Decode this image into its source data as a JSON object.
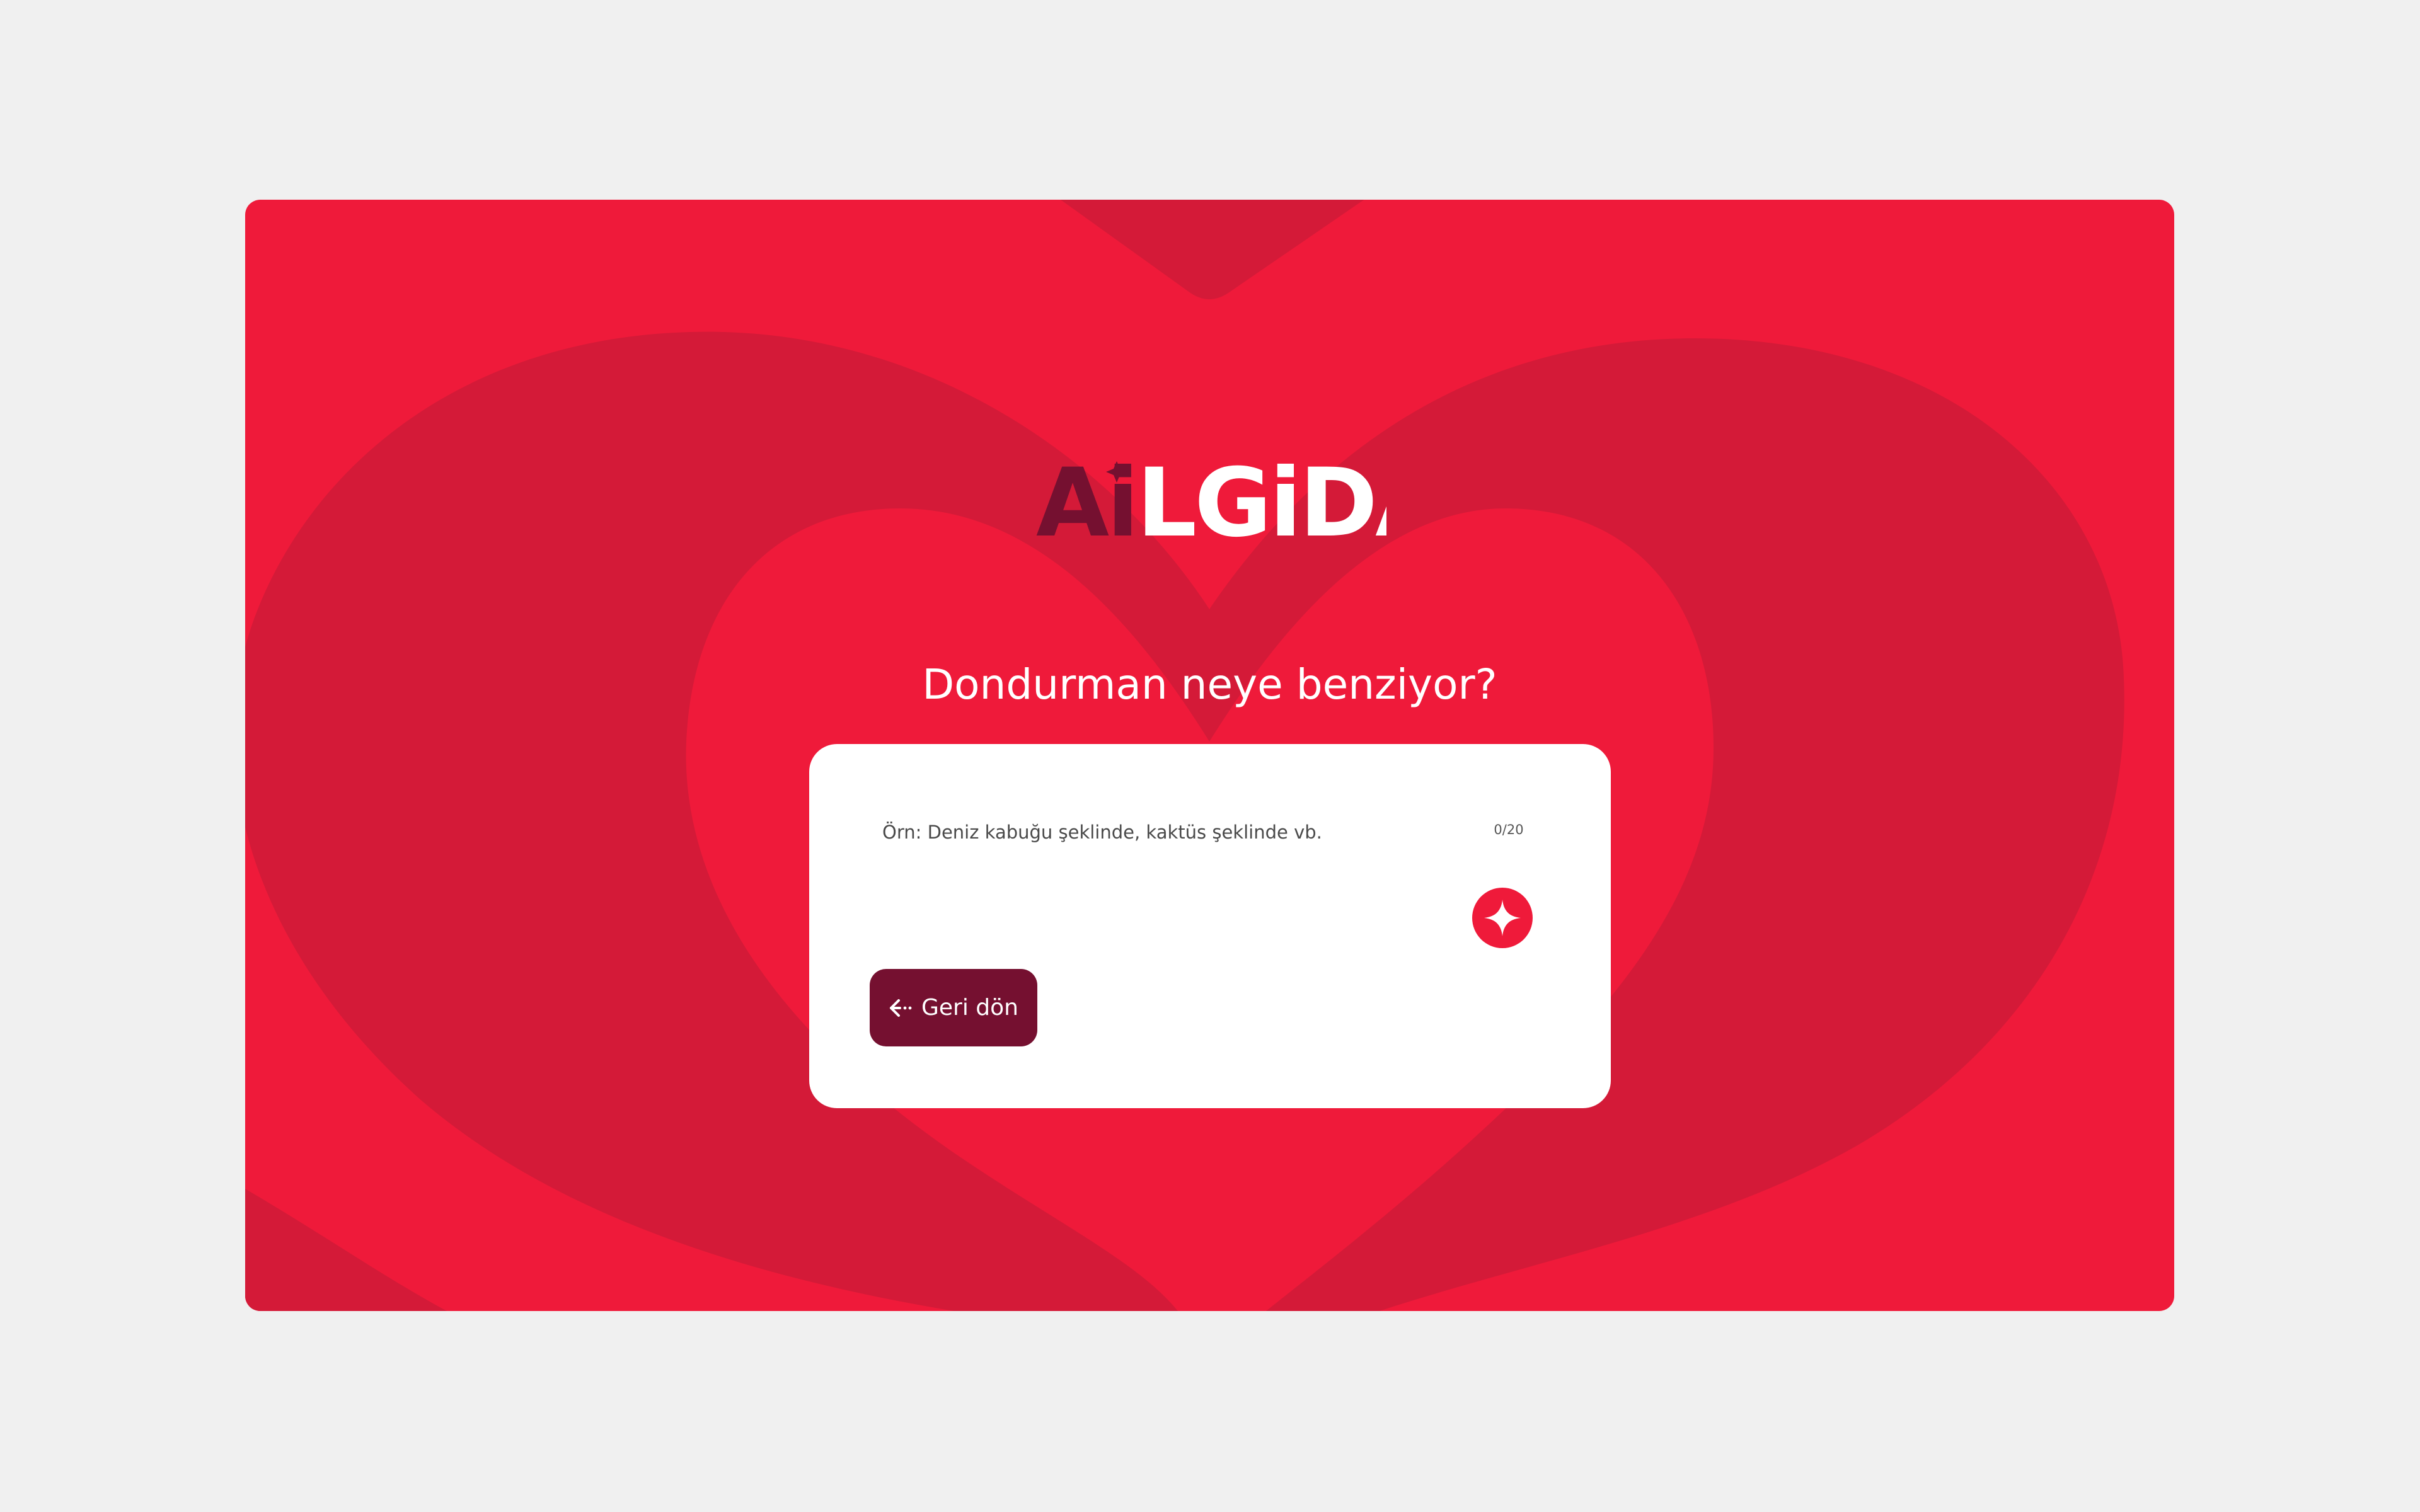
{
  "brand": {
    "logo_prefix": "Ai",
    "logo_rest": "LGiDA",
    "logo_accent_color": "#751030",
    "logo_main_color": "#ffffff"
  },
  "colors": {
    "background": "#f0f0f0",
    "card_red": "#ef1a3a",
    "heart_shade": "#d41a38",
    "button_dark": "#751030",
    "panel_white": "#ffffff"
  },
  "main": {
    "question": "Dondurman neye benziyor?",
    "input": {
      "value": "",
      "placeholder": "Örn: Deniz kabuğu şeklinde, kaktüs şeklinde vb."
    },
    "char_count": "0/20",
    "submit_icon": "sparkle-icon",
    "back_label": "Geri dön",
    "back_icon": "arrow-left-icon"
  }
}
